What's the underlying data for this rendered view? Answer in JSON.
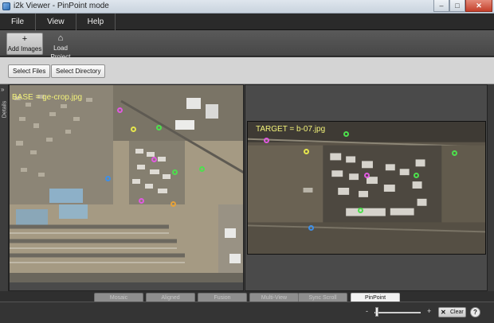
{
  "window": {
    "title": "i2k Viewer - PinPoint mode",
    "controls": {
      "minimize": "–",
      "maximize": "□",
      "close": "✕"
    }
  },
  "menu": [
    {
      "label": "File"
    },
    {
      "label": "View"
    },
    {
      "label": "Help"
    }
  ],
  "toolbar": {
    "add_images": {
      "label": "Add Images",
      "icon": "plus-icon",
      "glyph": "+"
    },
    "load_project": {
      "label": "Load Project",
      "icon": "load-project-icon",
      "glyph": "⌂"
    }
  },
  "buttons": {
    "select_files": "Select Files",
    "select_directory": "Select Directory"
  },
  "details": {
    "label": "Details",
    "arrow": "»"
  },
  "base_panel": {
    "caption": "BASE = ge-crop.jpg"
  },
  "target_panel": {
    "caption": "TARGET = b-07.jpg"
  },
  "colors": {
    "caption": "#f3f37a",
    "pin_green": "#4de04d",
    "pin_yellow": "#e6e64d",
    "pin_magenta": "#e05ae0",
    "pin_blue": "#3f8fe6",
    "pin_orange": "#e6a23a"
  },
  "tabs": [
    {
      "label": "Mosaic",
      "active": false
    },
    {
      "label": "Aligned",
      "active": false
    },
    {
      "label": "Fusion",
      "active": false
    },
    {
      "label": "Multi-View",
      "active": false
    },
    {
      "label": "Sync Scroll",
      "active": false
    },
    {
      "label": "PinPoint",
      "active": true
    }
  ],
  "status": {
    "zoom_minus": "-",
    "zoom_plus": "+",
    "clear_label": "Clear",
    "clear_glyph": "✕",
    "help_glyph": "?"
  }
}
